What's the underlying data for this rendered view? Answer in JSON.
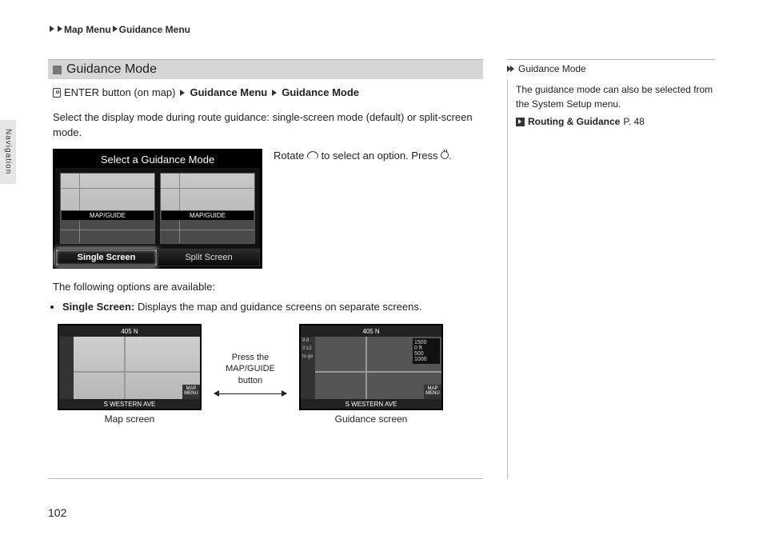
{
  "breadcrumb": {
    "part1": "Map Menu",
    "part2": "Guidance Menu"
  },
  "sideTab": "Navigation",
  "section": {
    "title": "Guidance Mode",
    "pathPrefix": "ENTER button (on map)",
    "pathStep1": "Guidance Menu",
    "pathStep2": "Guidance Mode",
    "intro": "Select the display mode during route guidance: single-screen mode (default) or split-screen mode.",
    "rotateLine1": "Rotate",
    "rotateLine2": "to select an option. Press",
    "optionsIntro": "The following options are available:",
    "bulletLabel": "Single Screen:",
    "bulletText": "Displays the map and guidance screens on separate screens."
  },
  "guidanceShot": {
    "title": "Select a Guidance Mode",
    "thumbLabel": "MAP/GUIDE",
    "btnLeft": "Single Screen",
    "btnRight": "Split Screen"
  },
  "miniMap": {
    "road": "405 N",
    "southRoad": "S WESTERN AVE",
    "corner": "MAP MENU",
    "distA": "1500",
    "distB": "0 ft",
    "distC": "500",
    "distD": "1000",
    "leftCaption": "Map screen",
    "rightCaption": "Guidance screen",
    "sideVals": {
      "a": "9.8",
      "b": "0:12",
      "c": "to go"
    }
  },
  "arrow": {
    "l1": "Press the",
    "l2": "MAP/GUIDE",
    "l3": "button"
  },
  "rightCol": {
    "head": "Guidance Mode",
    "body": "The guidance mode can also be selected from the System Setup menu.",
    "refLabel": "Routing & Guidance",
    "refPage": "P. 48"
  },
  "pageNumber": "102"
}
